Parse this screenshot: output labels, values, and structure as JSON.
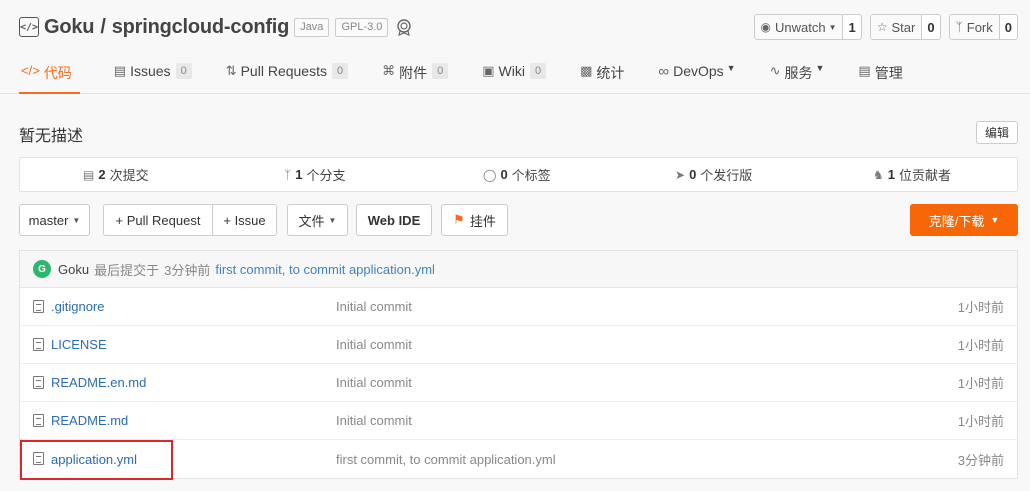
{
  "repo": {
    "owner": "Goku",
    "separator": "/",
    "name": "springcloud-config",
    "tags": [
      "Java",
      "GPL-3.0"
    ]
  },
  "actions": [
    {
      "label": "Unwatch",
      "count": "1",
      "icon": "eye-icon",
      "dropdown": true
    },
    {
      "label": "Star",
      "count": "0",
      "icon": "star-icon"
    },
    {
      "label": "Fork",
      "count": "0",
      "icon": "fork-icon"
    }
  ],
  "tabs": [
    {
      "label": "代码",
      "icon": "code-icon",
      "active": true
    },
    {
      "label": "Issues",
      "count": "0",
      "icon": "issues-icon"
    },
    {
      "label": "Pull Requests",
      "count": "0",
      "icon": "pull-request-icon"
    },
    {
      "label": "附件",
      "count": "0",
      "icon": "attachment-icon"
    },
    {
      "label": "Wiki",
      "count": "0",
      "icon": "wiki-icon"
    },
    {
      "label": "统计",
      "icon": "chart-icon"
    },
    {
      "label": "DevOps",
      "icon": "devops-icon",
      "dropdown": true
    },
    {
      "label": "服务",
      "icon": "service-icon",
      "dropdown": true
    },
    {
      "label": "管理",
      "icon": "manage-icon"
    }
  ],
  "description": "暂无描述",
  "edit_label": "编辑",
  "stats": [
    {
      "num": "2",
      "label": "次提交",
      "icon": "commit-icon"
    },
    {
      "num": "1",
      "label": "个分支",
      "icon": "branch-icon"
    },
    {
      "num": "0",
      "label": "个标签",
      "icon": "tag-icon"
    },
    {
      "num": "0",
      "label": "个发行版",
      "icon": "release-icon"
    },
    {
      "num": "1",
      "label": "位贡献者",
      "icon": "contributor-icon"
    }
  ],
  "toolbar": {
    "branch": "master",
    "pull_request": "+ Pull Request",
    "issue": "+ Issue",
    "files": "文件",
    "web_ide": "Web IDE",
    "pendant": "挂件",
    "clone": "克隆/下载"
  },
  "last_commit": {
    "avatar_letter": "G",
    "author": "Goku",
    "prefix": "最后提交于",
    "ago": "3分钟前",
    "message": "first commit, to commit application.yml"
  },
  "files": [
    {
      "name": ".gitignore",
      "message": "Initial commit",
      "time": "1小时前"
    },
    {
      "name": "LICENSE",
      "message": "Initial commit",
      "time": "1小时前"
    },
    {
      "name": "README.en.md",
      "message": "Initial commit",
      "time": "1小时前"
    },
    {
      "name": "README.md",
      "message": "Initial commit",
      "time": "1小时前"
    },
    {
      "name": "application.yml",
      "message": "first commit, to commit application.yml",
      "time": "3分钟前",
      "highlighted": true
    }
  ],
  "colors": {
    "accent": "#f36c21",
    "clone_button": "#f76707",
    "link": "#2a6db0",
    "highlight_box": "#d9272e",
    "avatar": "#2bb76c"
  }
}
